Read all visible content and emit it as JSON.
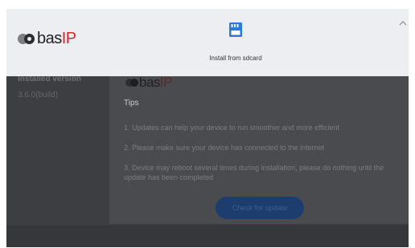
{
  "background": {
    "installed_version_label": "Installed version",
    "installed_version_value": "3.6.0(build)",
    "logo": {
      "name": "bas",
      "suffix": "IP"
    },
    "tips_title": "Tips",
    "tips": [
      "1. Updates can help your device to run smoother and more efficient",
      "2. Please make sure your device has connected to the internet",
      "3. Device may reboot several times during installation, please do nothing until the update has been completed"
    ],
    "check_button_label": "Check for update"
  },
  "sheet": {
    "logo": {
      "name": "bas",
      "suffix": "IP"
    },
    "install_option": {
      "icon": "sd-card-icon",
      "label": "Install from sdcard"
    },
    "collapse_icon": "chevron-up-icon"
  },
  "colors": {
    "brand_red": "#d9262b",
    "accent_blue": "#2a7be0"
  }
}
